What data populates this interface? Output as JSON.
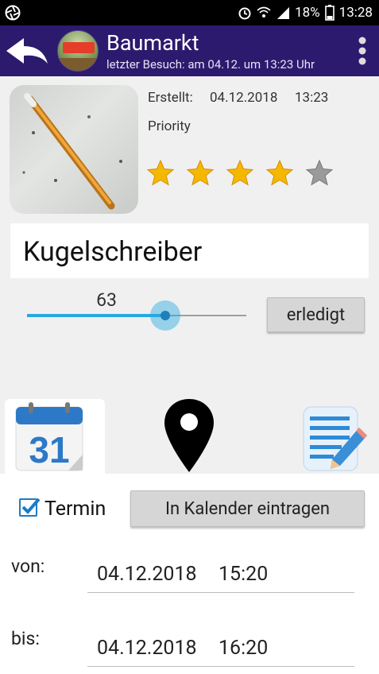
{
  "status_bar": {
    "battery_percent": "18%",
    "time": "13:28",
    "icons": [
      "aperture-icon",
      "alarm-icon",
      "wifi-icon",
      "signal-icon",
      "battery-icon"
    ]
  },
  "app_bar": {
    "title": "Baumarkt",
    "subtitle": "letzter Besuch: am 04.12. um 13:23 Uhr",
    "icons": [
      "back-arrow-icon",
      "store-avatar",
      "overflow-menu-icon"
    ]
  },
  "item": {
    "created_label": "Erstellt:",
    "created_date": "04.12.2018",
    "created_time": "13:23",
    "priority_label": "Priority",
    "priority_rating": 4,
    "priority_max": 5,
    "name": "Kugelschreiber",
    "quantity": "63",
    "quantity_max": 100,
    "done_button": "erledigt"
  },
  "actions": {
    "calendar_day": "31",
    "icons": [
      "calendar-icon",
      "location-pin-icon",
      "note-edit-icon"
    ]
  },
  "appointment": {
    "checkbox_label": "Termin",
    "checked": true,
    "calendar_button": "In Kalender eintragen",
    "from_label": "von:",
    "from_date": "04.12.2018",
    "from_time": "15:20",
    "to_label": "bis:",
    "to_date": "04.12.2018",
    "to_time": "16:20"
  },
  "colors": {
    "app_bar": "#2b1a6e",
    "accent": "#29a8e0",
    "star_on": "#f5b800",
    "star_off": "#9a9a9a"
  }
}
